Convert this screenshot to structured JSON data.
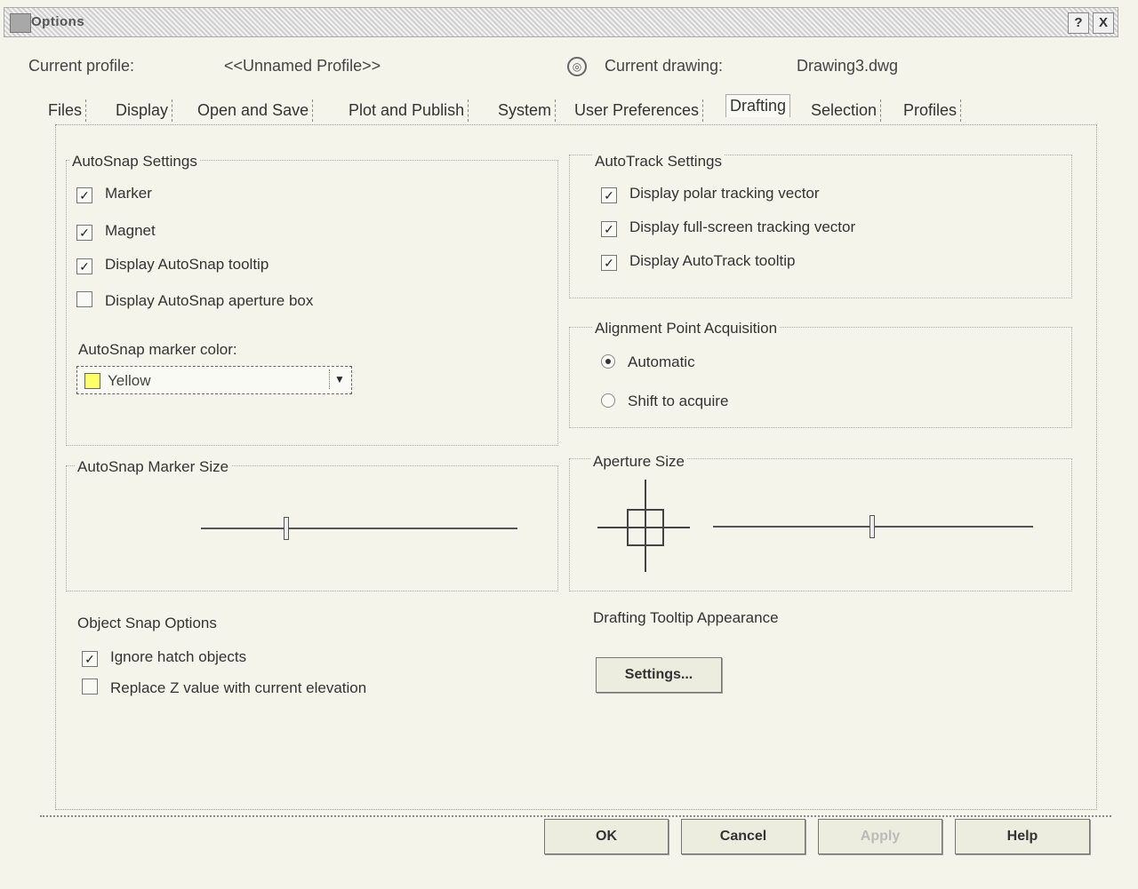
{
  "window": {
    "title": "Options",
    "help_label": "?",
    "close_label": "X"
  },
  "profile": {
    "current_profile_label": "Current profile:",
    "current_profile_value": "<<Unnamed Profile>>",
    "current_drawing_label": "Current drawing:",
    "current_drawing_value": "Drawing3.dwg"
  },
  "tabs": [
    {
      "label": "Files"
    },
    {
      "label": "Display"
    },
    {
      "label": "Open and Save"
    },
    {
      "label": "Plot and Publish"
    },
    {
      "label": "System"
    },
    {
      "label": "User Preferences"
    },
    {
      "label": "Drafting"
    },
    {
      "label": "Selection"
    },
    {
      "label": "Profiles"
    }
  ],
  "autosnap": {
    "title": "AutoSnap Settings",
    "marker": {
      "label": "Marker",
      "checked": true
    },
    "magnet": {
      "label": "Magnet",
      "checked": true
    },
    "tooltip": {
      "label": "Display AutoSnap tooltip",
      "checked": true
    },
    "aperture_box": {
      "label": "Display AutoSnap aperture box",
      "checked": false
    },
    "color_label": "AutoSnap marker color:",
    "color_value": "Yellow",
    "color_hex": "#ffff66"
  },
  "autotrack": {
    "title": "AutoTrack Settings",
    "polar": {
      "label": "Display polar tracking vector",
      "checked": true
    },
    "fullscreen": {
      "label": "Display full-screen tracking vector",
      "checked": true
    },
    "tooltip": {
      "label": "Display AutoTrack tooltip",
      "checked": true
    }
  },
  "alignment": {
    "title": "Alignment Point Acquisition",
    "automatic": {
      "label": "Automatic",
      "selected": true
    },
    "shift": {
      "label": "Shift to acquire",
      "selected": false
    }
  },
  "marker_size": {
    "title": "AutoSnap Marker Size",
    "level": 0.26
  },
  "aperture_size": {
    "title": "Aperture Size",
    "level": 0.49
  },
  "object_snap": {
    "title": "Object Snap Options",
    "ignore_hatch": {
      "label": "Ignore hatch objects",
      "checked": true
    },
    "replace_z": {
      "label": "Replace Z value with current elevation",
      "checked": false
    }
  },
  "drafting_tooltip": {
    "title": "Drafting Tooltip Appearance",
    "settings_label": "Settings..."
  },
  "footer": {
    "ok_label": "OK",
    "cancel_label": "Cancel",
    "apply_label": "Apply",
    "help_label": "Help"
  }
}
